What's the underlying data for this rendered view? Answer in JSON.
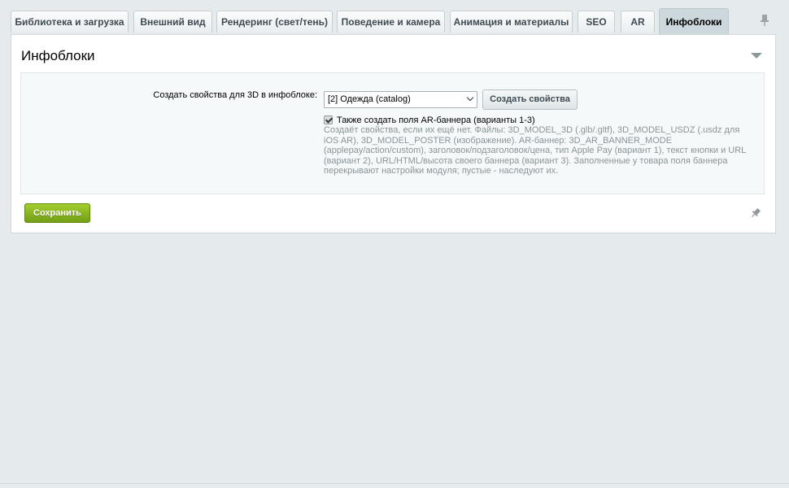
{
  "tabs": [
    {
      "label": "Библиотека и загрузка",
      "active": false
    },
    {
      "label": "Внешний вид",
      "active": false
    },
    {
      "label": "Рендеринг (свет/тень)",
      "active": false
    },
    {
      "label": "Поведение и камера",
      "active": false
    },
    {
      "label": "Анимация и материалы",
      "active": false
    },
    {
      "label": "SEO",
      "active": false
    },
    {
      "label": "AR",
      "active": false
    },
    {
      "label": "Инфоблоки",
      "active": true
    }
  ],
  "panel": {
    "title": "Инфоблоки",
    "iblock_field": {
      "label": "Создать свойства для 3D в инфоблоке:",
      "selected_value": "[2] Одежда (catalog)",
      "create_button": "Создать свойства"
    },
    "ar_checkbox": {
      "label": "Также создать поля AR-баннера (варианты 1-3)",
      "checked": true
    },
    "hint": "Создаёт свойства, если их ещё нет. Файлы: 3D_MODEL_3D (.glb/.gltf), 3D_MODEL_USDZ (.usdz для iOS AR), 3D_MODEL_POSTER (изображение). AR-баннер: 3D_AR_BANNER_MODE (applepay/action/custom), заголовок/подзаголовок/цена, тип Apple Pay (вариант 1), текст кнопки и URL (вариант 2), URL/HTML/высота своего баннера (вариант 3). Заполненные у товара поля баннера перекрывают настройки модуля; пустые - наследуют их."
  },
  "save_button": "Сохранить",
  "icons": {
    "pin": "pin-icon",
    "collapse": "collapse-arrow-icon",
    "checkbox": "checkmark-icon",
    "select": "chevron-down-icon"
  },
  "colors": {
    "background": "#e5ebed",
    "active_tab": "#cdd8dc",
    "save_button": "#8ab523",
    "hint_text": "#8b9498"
  }
}
